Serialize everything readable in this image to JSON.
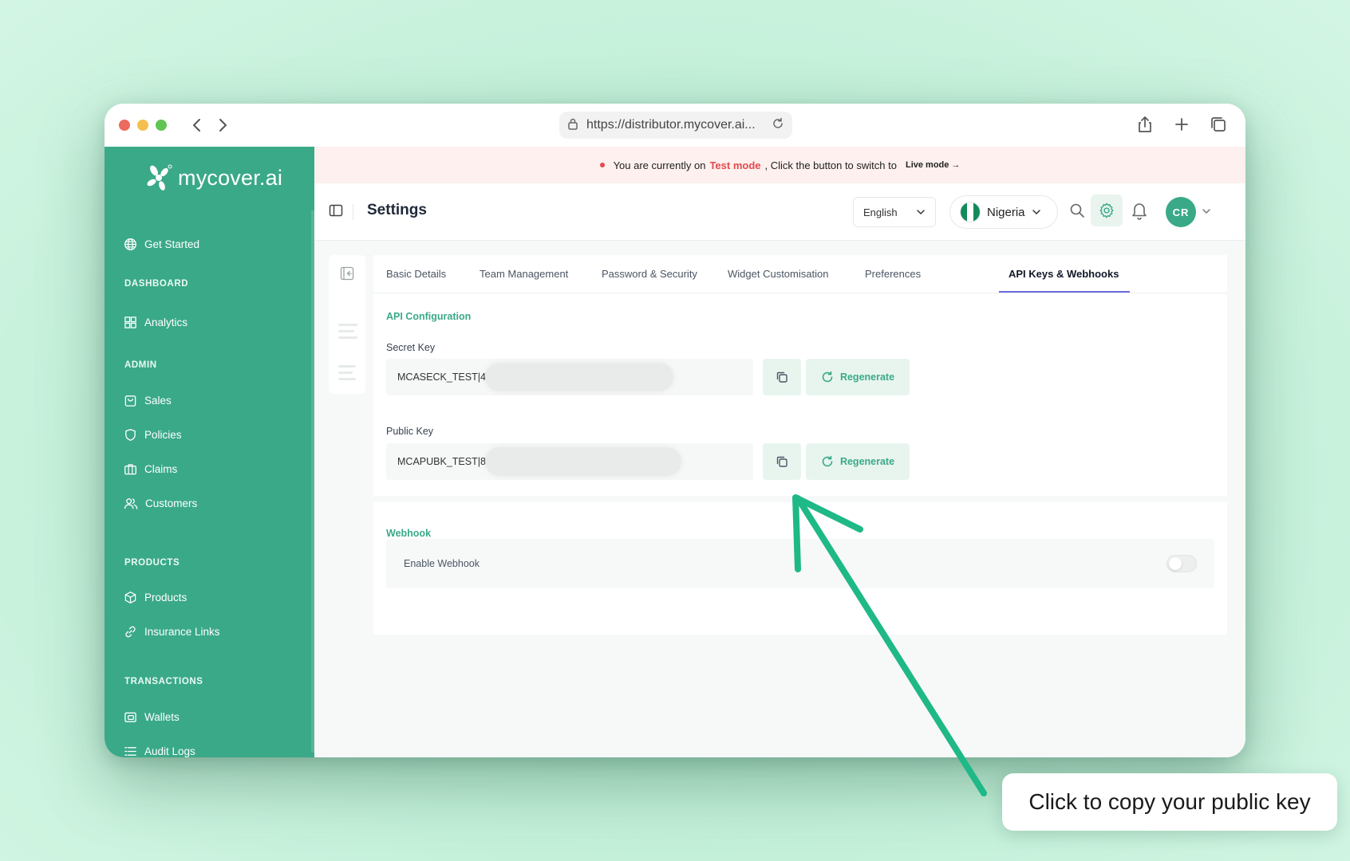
{
  "browser": {
    "url": "https://distributor.mycover.ai...",
    "controls": [
      "back-icon",
      "forward-icon",
      "lock-icon",
      "reload-icon",
      "share-icon",
      "new-tab-icon",
      "tabs-overview-icon"
    ]
  },
  "brand": {
    "name": "mycover.ai",
    "accent": "#3aa988"
  },
  "sidebar": {
    "get_started": "Get Started",
    "sections": {
      "dashboard": "DASHBOARD",
      "admin": "ADMIN",
      "products": "PRODUCTS",
      "transactions": "TRANSACTIONS"
    },
    "items": {
      "analytics": "Analytics",
      "sales": "Sales",
      "policies": "Policies",
      "claims": "Claims",
      "customers": "Customers",
      "products": "Products",
      "insurance_links": "Insurance Links",
      "wallets": "Wallets",
      "audit_logs": "Audit Logs"
    }
  },
  "banner": {
    "prefix": "You are currently on",
    "mode": "Test mode",
    "suffix": ", Click the button to switch to",
    "live": "Live mode →"
  },
  "header": {
    "title": "Settings",
    "language": "English",
    "country": "Nigeria",
    "avatar_initials": "CR"
  },
  "tabs": [
    "Basic Details",
    "Team Management",
    "Password & Security",
    "Widget Customisation",
    "Preferences",
    "API Keys & Webhooks"
  ],
  "active_tab": "API Keys & Webhooks",
  "api": {
    "section_title": "API Configuration",
    "secret_label": "Secret Key",
    "secret_value": "MCASECK_TEST|44",
    "public_label": "Public Key",
    "public_value": "MCAPUBK_TEST|86",
    "regenerate": "Regenerate"
  },
  "webhook": {
    "section_title": "Webhook",
    "enable_label": "Enable Webhook",
    "enabled": false
  },
  "annotation": {
    "callout": "Click to copy your public key",
    "arrow_color": "#1fb887"
  }
}
